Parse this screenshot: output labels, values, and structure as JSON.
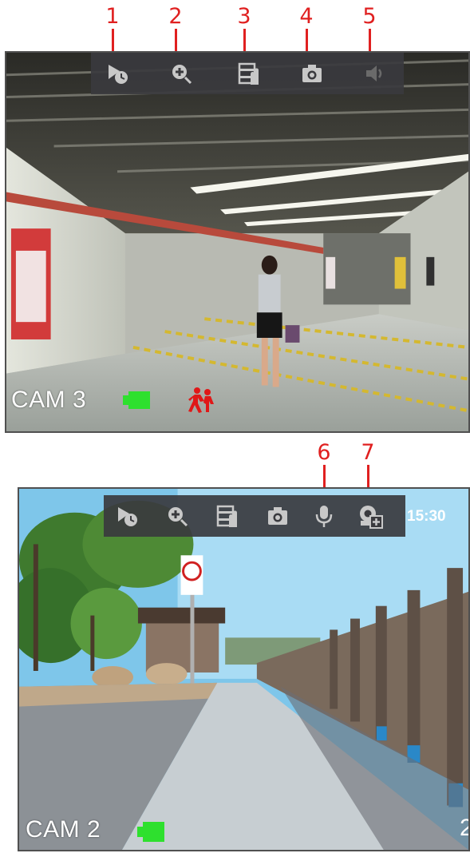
{
  "callouts": [
    "1",
    "2",
    "3",
    "4",
    "5",
    "6",
    "7"
  ],
  "panel_top": {
    "camera_label": "CAM 3",
    "toolbar_icons": [
      "instant-playback-icon",
      "digital-zoom-icon",
      "real-time-backup-icon",
      "snapshot-icon",
      "audio-mute-icon"
    ],
    "status_icons": [
      "recording-icon",
      "motion-detection-icon"
    ]
  },
  "panel_bottom": {
    "camera_label": "CAM 2",
    "time_fragment": "15:30",
    "edge_fragment": "2",
    "toolbar_icons": [
      "instant-playback-icon",
      "digital-zoom-icon",
      "real-time-backup-icon",
      "snapshot-icon",
      "two-way-talk-icon",
      "switch-to-ip-camera-icon"
    ],
    "status_icons": [
      "recording-icon"
    ]
  },
  "colors": {
    "callout": "#e02020",
    "toolbar_bg": "#3a3a3e",
    "icon": "#c8c8c8",
    "icon_disabled": "#6a6a6a",
    "record": "#2ee02e",
    "motion": "#e01818"
  }
}
